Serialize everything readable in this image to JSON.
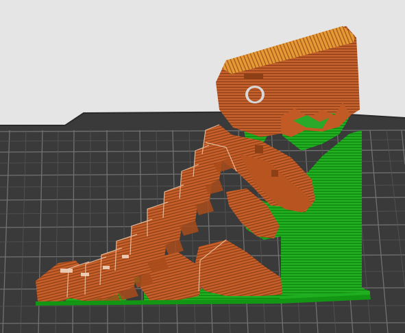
{
  "viewport": {
    "view": "layer-preview",
    "background_color": "#e5e5e5",
    "bed_color": "#3a3a3a",
    "grid_color": "#6e6e6e"
  },
  "model": {
    "feature_colors": {
      "perimeter": "#c4602b",
      "perimeter_shadow": "#9a4519",
      "infill_line": "#8a3d16",
      "top_surface": "#e0932f",
      "support": "#1fb01f",
      "support_line": "#108a10"
    }
  }
}
